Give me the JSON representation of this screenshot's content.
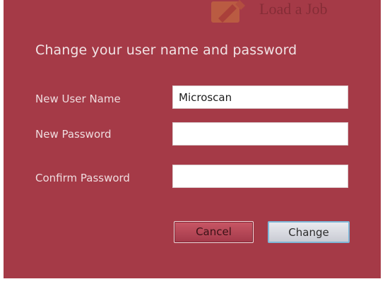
{
  "background_item": {
    "label": "Load a Job",
    "icon": "job-icon"
  },
  "dialog": {
    "title": "Change your user name and password",
    "fields": {
      "username": {
        "label": "New User Name",
        "value": "Microscan"
      },
      "password": {
        "label": "New Password",
        "value": ""
      },
      "confirm": {
        "label": "Confirm Password",
        "value": ""
      }
    },
    "buttons": {
      "cancel": "Cancel",
      "change": "Change"
    }
  },
  "colors": {
    "dialog_background": "#a53a47",
    "field_background": "#ffffff",
    "focus_border": "#7fb7d8"
  }
}
